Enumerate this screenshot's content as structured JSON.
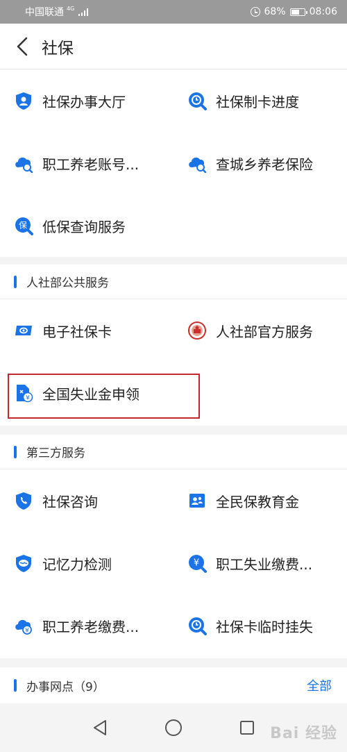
{
  "status_bar": {
    "carrier": "中国联通",
    "network": "4G",
    "battery": "68%",
    "battery_level": 0.68,
    "time": "08:06"
  },
  "header": {
    "title": "社保",
    "back_icon": "chevron-left-icon"
  },
  "social_security": {
    "items": [
      {
        "label": "社保办事大厅",
        "icon": "shield-user-icon"
      },
      {
        "label": "社保制卡进度",
        "icon": "progress-search-icon"
      },
      {
        "label": "职工养老账号...",
        "icon": "cloud-search-icon"
      },
      {
        "label": "查城乡养老保险",
        "icon": "cloud-search-icon"
      },
      {
        "label": "低保查询服务",
        "icon": "bao-search-icon"
      }
    ]
  },
  "mohrss": {
    "title": "人社部公共服务",
    "items": [
      {
        "label": "电子社保卡",
        "icon": "ecard-icon"
      },
      {
        "label": "人社部官方服务",
        "icon": "emblem-icon"
      },
      {
        "label": "全国失业金申领",
        "icon": "document-yuan-icon"
      }
    ]
  },
  "third_party": {
    "title": "第三方服务",
    "items": [
      {
        "label": "社保咨询",
        "icon": "shield-phone-icon"
      },
      {
        "label": "全民保教育金",
        "icon": "people-card-icon"
      },
      {
        "label": "记忆力检测",
        "icon": "brain-shield-icon"
      },
      {
        "label": "职工失业缴费...",
        "icon": "yuan-circle-icon"
      },
      {
        "label": "职工养老缴费...",
        "icon": "cloud-yuan-icon"
      },
      {
        "label": "社保卡临时挂失",
        "icon": "progress-search-icon"
      }
    ]
  },
  "offices": {
    "title": "办事网点（9）",
    "more_label": "全部"
  },
  "colors": {
    "accent": "#1a74e8",
    "highlight": "#c3262c"
  },
  "watermark": "Bai 经验"
}
